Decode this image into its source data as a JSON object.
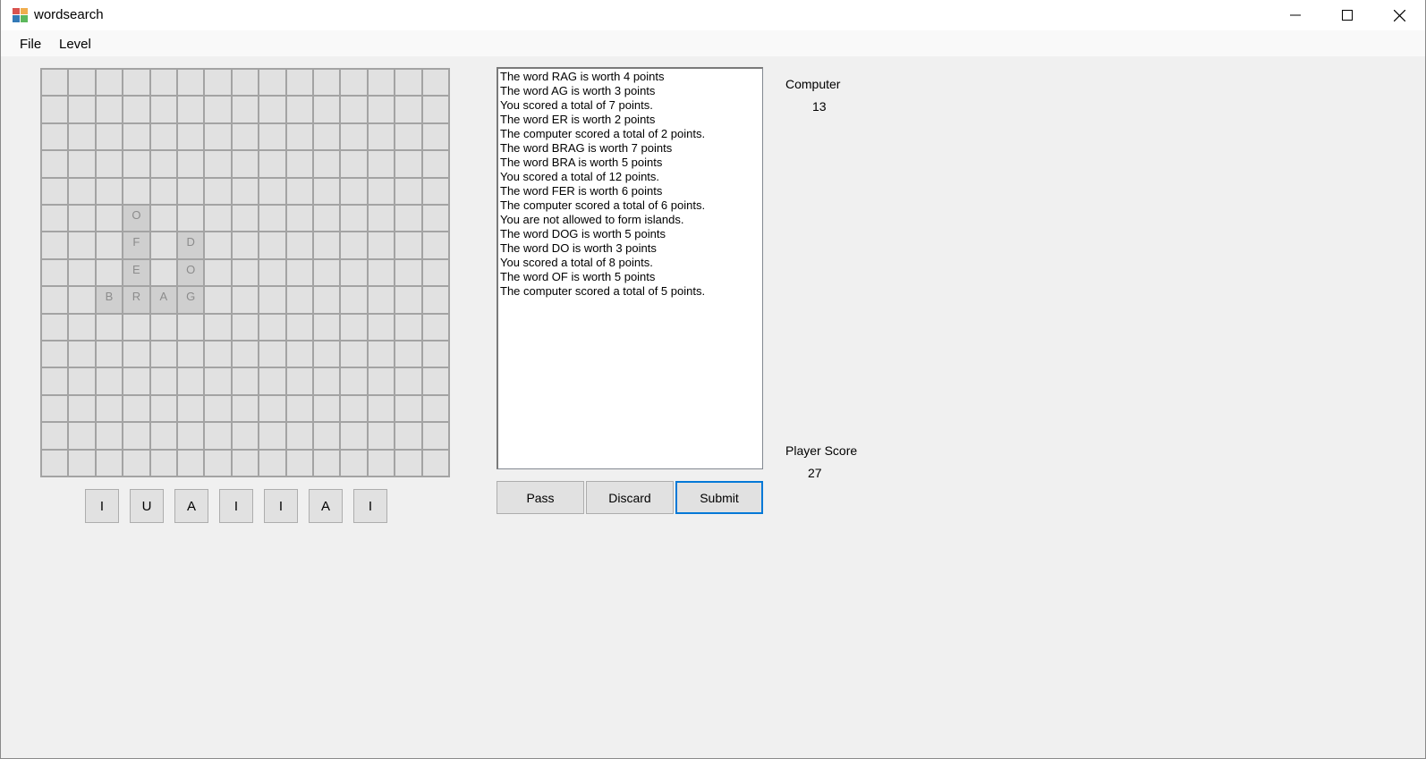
{
  "window": {
    "title": "wordsearch"
  },
  "menu": {
    "items": [
      "File",
      "Level"
    ]
  },
  "board": {
    "size": 15,
    "tiles": [
      {
        "row": 5,
        "col": 3,
        "letter": "O"
      },
      {
        "row": 6,
        "col": 3,
        "letter": "F"
      },
      {
        "row": 6,
        "col": 5,
        "letter": "D"
      },
      {
        "row": 7,
        "col": 3,
        "letter": "E"
      },
      {
        "row": 7,
        "col": 5,
        "letter": "O"
      },
      {
        "row": 8,
        "col": 2,
        "letter": "B"
      },
      {
        "row": 8,
        "col": 3,
        "letter": "R"
      },
      {
        "row": 8,
        "col": 4,
        "letter": "A"
      },
      {
        "row": 8,
        "col": 5,
        "letter": "G"
      }
    ]
  },
  "rack": {
    "letters": [
      "I",
      "U",
      "A",
      "I",
      "I",
      "A",
      "I"
    ]
  },
  "log": {
    "lines": [
      "The word RAG is worth 4 points",
      "The word AG is worth 3 points",
      "You scored a total of 7 points.",
      "The word ER is worth 2 points",
      "The computer scored a total of 2 points.",
      "The word BRAG is worth 7 points",
      "The word BRA is worth 5 points",
      "You scored a total of 12 points.",
      "The word FER is worth 6 points",
      "The computer scored a total of 6 points.",
      "You are not allowed to form islands.",
      "The word DOG is worth 5 points",
      "The word DO is worth 3 points",
      "You scored a total of 8 points.",
      "The word OF is worth 5 points",
      "The computer scored a total of 5 points."
    ]
  },
  "buttons": {
    "pass": "Pass",
    "discard": "Discard",
    "submit": "Submit"
  },
  "scores": {
    "computer_label": "Computer",
    "computer_value": "13",
    "player_label": "Player Score",
    "player_value": "27"
  }
}
